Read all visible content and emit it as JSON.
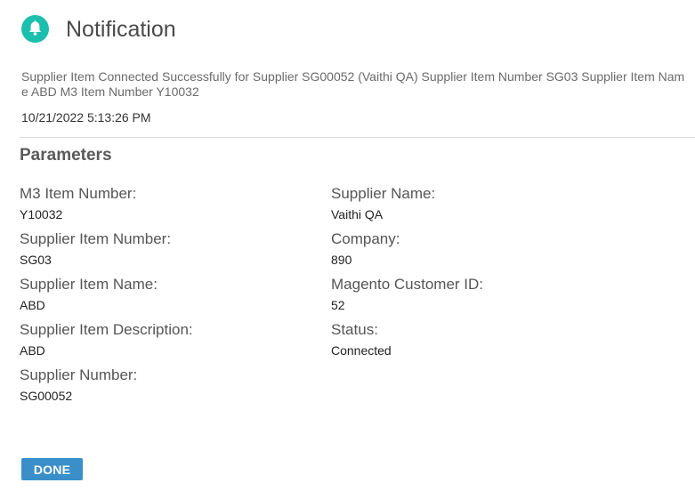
{
  "header": {
    "icon": "bell-icon",
    "icon_color": "#1cbfae",
    "title": "Notification"
  },
  "message": "Supplier Item Connected Successfully for Supplier SG00052 (Vaithi QA) Supplier Item Number SG03 Supplier Item Name ABD M3 Item Number Y10032",
  "timestamp": "10/21/2022 5:13:26 PM",
  "parameters": {
    "heading": "Parameters",
    "left": [
      {
        "label": "M3 Item Number:",
        "value": "Y10032"
      },
      {
        "label": "Supplier Item Number:",
        "value": "SG03"
      },
      {
        "label": "Supplier Item Name:",
        "value": "ABD"
      },
      {
        "label": "Supplier Item Description:",
        "value": "ABD"
      },
      {
        "label": "Supplier Number:",
        "value": "SG00052"
      }
    ],
    "right": [
      {
        "label": "Supplier Name:",
        "value": "Vaithi QA"
      },
      {
        "label": "Company:",
        "value": "890"
      },
      {
        "label": "Magento Customer ID:",
        "value": "52"
      },
      {
        "label": "Status:",
        "value": "Connected"
      }
    ]
  },
  "actions": {
    "done_label": "DONE",
    "done_color": "#3a8fc9"
  }
}
